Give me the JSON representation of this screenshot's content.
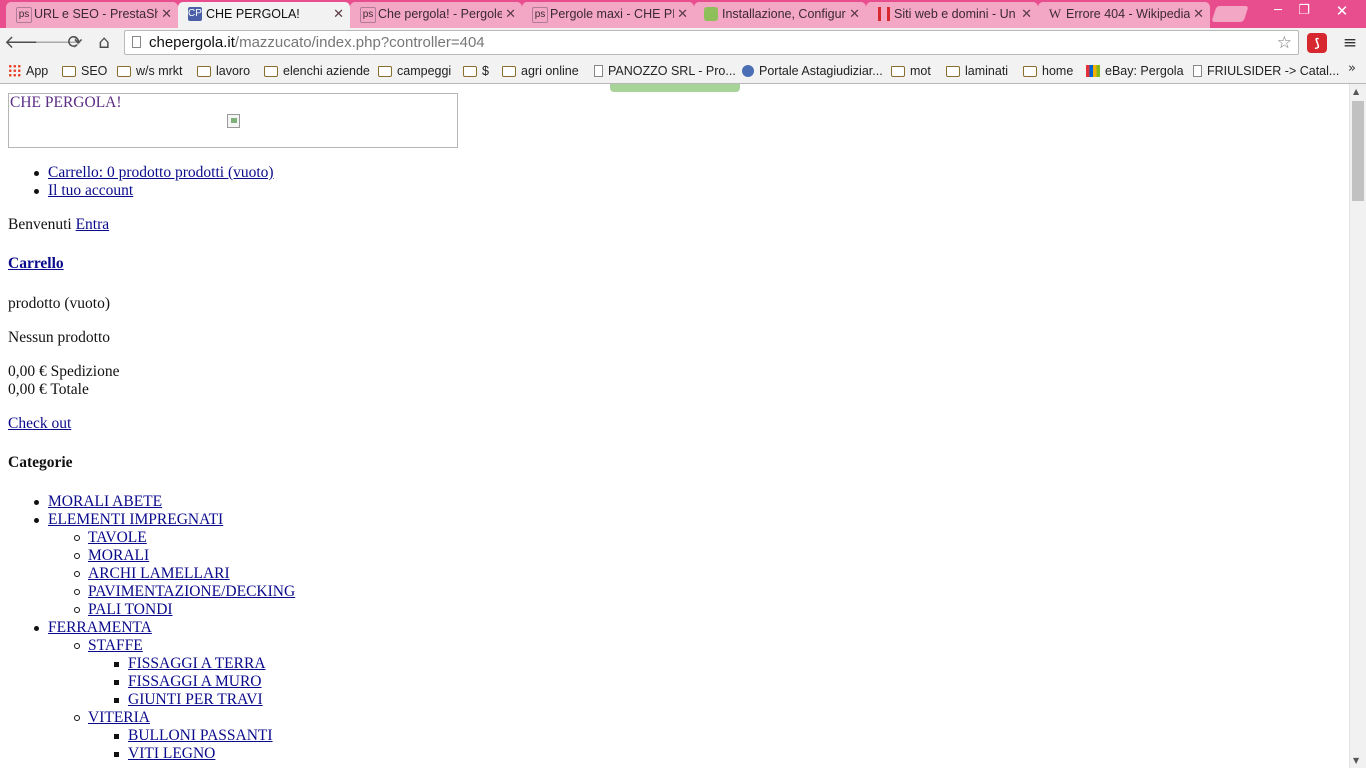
{
  "browser": {
    "tabs": [
      {
        "title": "URL e SEO - PrestaSho",
        "favicon": "prestashop-icon",
        "active": false
      },
      {
        "title": "CHE PERGOLA!",
        "favicon": "site-icon",
        "active": true
      },
      {
        "title": "Che pergola! - Pergole",
        "favicon": "prestashop-icon",
        "active": false
      },
      {
        "title": "Pergole maxi - CHE PE",
        "favicon": "prestashop-icon",
        "active": false
      },
      {
        "title": "Installazione, Configur",
        "favicon": "leaf-icon",
        "active": false
      },
      {
        "title": "Siti web e domini - Un",
        "favicon": "register-icon",
        "active": false
      },
      {
        "title": "Errore 404 - Wikipedia",
        "favicon": "wikipedia-icon",
        "active": false
      }
    ],
    "address": {
      "host": "chepergola.it",
      "path": "/mazzucato/index.php?controller=404"
    },
    "bookmarks": [
      {
        "label": "App",
        "icon": "apps-icon"
      },
      {
        "label": "SEO",
        "icon": "folder-icon"
      },
      {
        "label": "w/s mrkt",
        "icon": "folder-icon"
      },
      {
        "label": "lavoro",
        "icon": "folder-icon"
      },
      {
        "label": "elenchi aziende",
        "icon": "folder-icon"
      },
      {
        "label": "campeggi",
        "icon": "folder-icon"
      },
      {
        "label": "$",
        "icon": "folder-icon"
      },
      {
        "label": "agri online",
        "icon": "folder-icon"
      },
      {
        "label": "PANOZZO SRL - Pro...",
        "icon": "page-icon"
      },
      {
        "label": "Portale Astagiudiziar...",
        "icon": "globe-icon"
      },
      {
        "label": "mot",
        "icon": "folder-icon"
      },
      {
        "label": "laminati",
        "icon": "folder-icon"
      },
      {
        "label": "home",
        "icon": "folder-icon"
      },
      {
        "label": "eBay: Pergola",
        "icon": "ebay-icon"
      },
      {
        "label": "FRIULSIDER -> Catal...",
        "icon": "page-icon"
      }
    ],
    "bookmarks_overflow": "»"
  },
  "page": {
    "site_name": "CHE PERGOLA!",
    "header_links": [
      "Carrello: 0 prodotto prodotti (vuoto)",
      "Il tuo account"
    ],
    "welcome_text": "Benvenuti",
    "login_link": "Entra",
    "cart_heading": "Carrello",
    "cart_empty": "prodotto (vuoto)",
    "no_products": "Nessun prodotto",
    "shipping": "0,00 € Spedizione",
    "total": "0,00 € Totale",
    "checkout": "Check out",
    "categories_heading": "Categorie",
    "categories": [
      {
        "label": "MORALI ABETE",
        "level": 1
      },
      {
        "label": "ELEMENTI IMPREGNATI",
        "level": 1
      },
      {
        "label": "TAVOLE",
        "level": 2
      },
      {
        "label": "MORALI",
        "level": 2
      },
      {
        "label": "ARCHI LAMELLARI",
        "level": 2
      },
      {
        "label": "PAVIMENTAZIONE/DECKING",
        "level": 2
      },
      {
        "label": "PALI TONDI",
        "level": 2
      },
      {
        "label": "FERRAMENTA",
        "level": 1
      },
      {
        "label": "STAFFE",
        "level": 2
      },
      {
        "label": "FISSAGGI A TERRA",
        "level": 3
      },
      {
        "label": "FISSAGGI A MURO",
        "level": 3
      },
      {
        "label": "GIUNTI PER TRAVI",
        "level": 3
      },
      {
        "label": "VITERIA",
        "level": 2
      },
      {
        "label": "BULLONI PASSANTI",
        "level": 3
      },
      {
        "label": "VITI LEGNO",
        "level": 3
      }
    ]
  }
}
